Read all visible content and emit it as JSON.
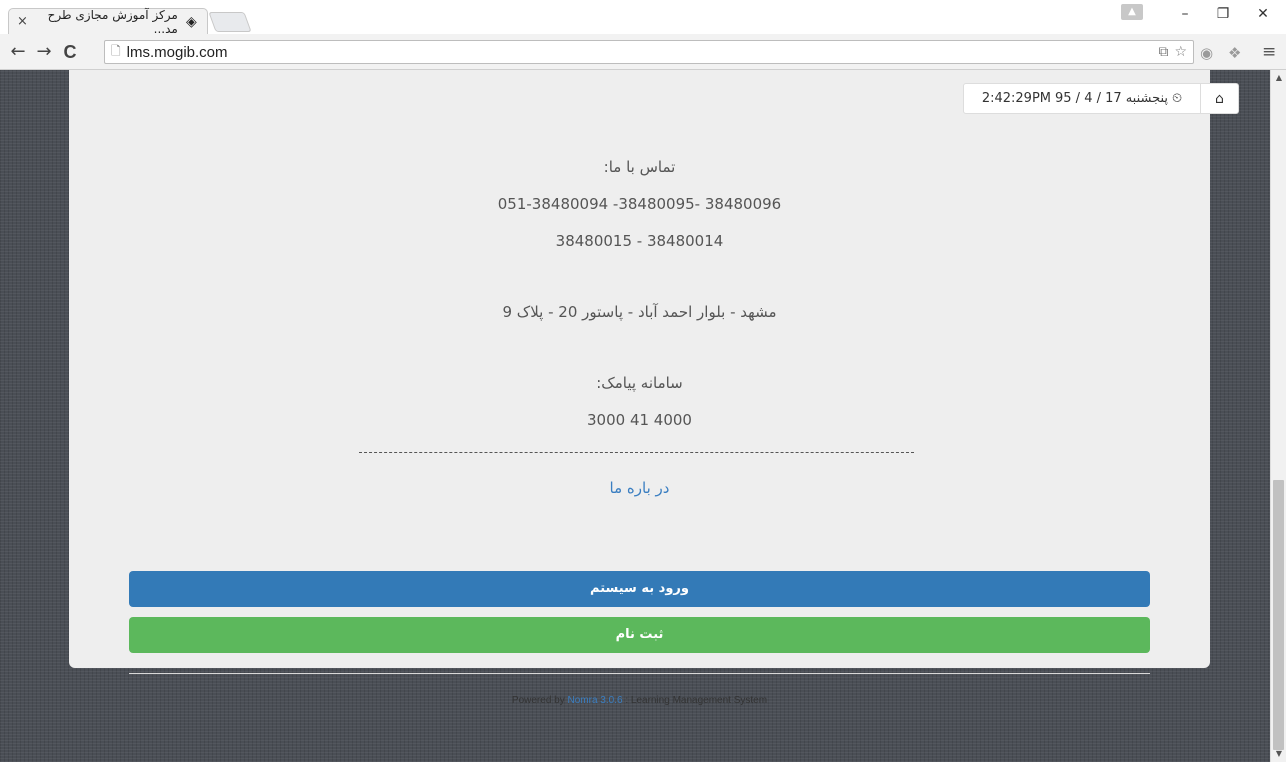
{
  "browser": {
    "tab_title": "مرکز آموزش مجازی طرح مد...",
    "tab_close": "×",
    "url": "lms.mogib.com"
  },
  "window_controls": {
    "minimize": "–",
    "restore": "❐",
    "close": "✕"
  },
  "nav": {
    "back": "←",
    "forward": "→",
    "reload": "C"
  },
  "contact": {
    "heading": "تماس با ما:",
    "phones_line1": "051-38480094 -38480095- 38480096",
    "phones_line2": "38480015 - 38480014",
    "address": "مشهد - بلوار احمد آباد - پاستور 20 - پلاک 9",
    "sms_heading": "سامانه پیامک:",
    "sms_number": "3000 41 4000"
  },
  "about_link": "در باره ما",
  "buttons": {
    "login": "ورود به سیستم",
    "register": "ثبت نام"
  },
  "footer": {
    "powered_by": "Powered by",
    "product": "Nomra 3.0.6",
    "suffix": ": Learning Management System"
  },
  "clock": {
    "weekday": "پنجشنبه",
    "date": "17 / 4 / 95",
    "time": "2:42:29PM"
  },
  "icons": {
    "clock": "clock-icon",
    "home": "home-icon",
    "favicon": "site-favicon-icon",
    "page": "page-icon",
    "translate": "translate-icon",
    "star": "star-icon",
    "menu": "menu-icon"
  },
  "colors": {
    "primary": "#337ab7",
    "success": "#5cb85c",
    "link": "#3a7ec1",
    "card_bg": "#eeeeee",
    "page_bg": "#4a4e55"
  }
}
